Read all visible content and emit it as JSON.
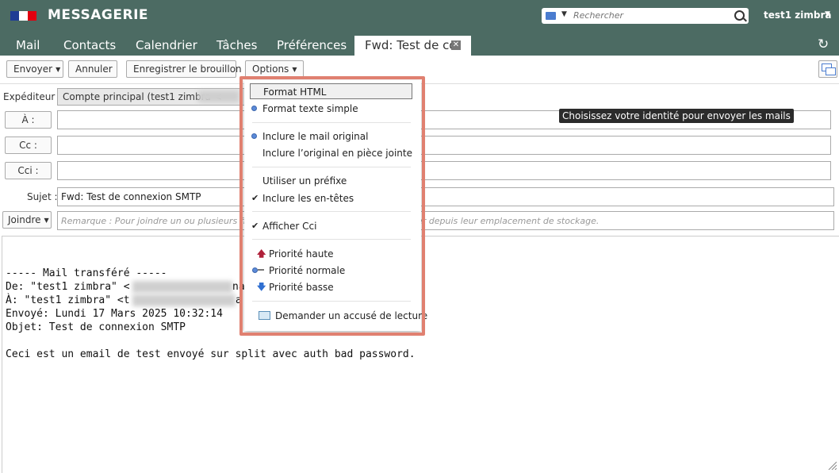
{
  "app": {
    "title": "MESSAGERIE",
    "flag_colors": [
      "#1f3c94",
      "#ffffff",
      "#e1000f"
    ]
  },
  "search": {
    "placeholder": "Rechercher"
  },
  "user": {
    "name": "test1 zimbra"
  },
  "tabs": [
    {
      "label": "Mail"
    },
    {
      "label": "Contacts"
    },
    {
      "label": "Calendrier"
    },
    {
      "label": "Tâches"
    },
    {
      "label": "Préférences"
    }
  ],
  "active_tab": {
    "label": "Fwd: Test de co"
  },
  "toolbar": {
    "send": "Envoyer",
    "cancel": "Annuler",
    "save_draft": "Enregistrer le brouillon",
    "options": "Options"
  },
  "compose": {
    "sender_label": "Expéditeur :",
    "sender_value": "Compte principal (test1 zimbra <",
    "to_label": "À :",
    "cc_label": "Cc :",
    "bcc_label": "Cci :",
    "subject_label": "Sujet :",
    "subject_value": "Fwd: Test de connexion SMTP",
    "attach_label": "Joindre",
    "attach_note_left": "Remarque : Pour joindre un ou plusieurs fichi",
    "attach_note_right": "er depuis leur emplacement de stockage."
  },
  "tooltip": "Choisissez votre identité pour envoyer les mails",
  "body": {
    "header": "----- Mail transféré -----",
    "from_prefix": "De: \"test1 zimbra\" <",
    "from_suffix": "na",
    "to_prefix": "À: \"test1 zimbra\" <t",
    "to_suffix": "a",
    "sent": "Envoyé: Lundi 17 Mars 2025 10:32:14",
    "subject": "Objet: Test de connexion SMTP",
    "text": "Ceci est un email de test envoyé sur split avec auth bad password."
  },
  "options_menu": {
    "highlight_color": "#e08070",
    "format_html": "Format HTML",
    "format_text": "Format texte simple",
    "include_original": "Inclure le mail original",
    "include_attachment": "Inclure l’original en pièce jointe",
    "use_prefix": "Utiliser un préfixe",
    "include_headers": "Inclure les en-têtes",
    "show_bcc": "Afficher Cci",
    "priority_high": "Priorité haute",
    "priority_normal": "Priorité normale",
    "priority_low": "Priorité basse",
    "read_receipt": "Demander un accusé de lecture"
  }
}
